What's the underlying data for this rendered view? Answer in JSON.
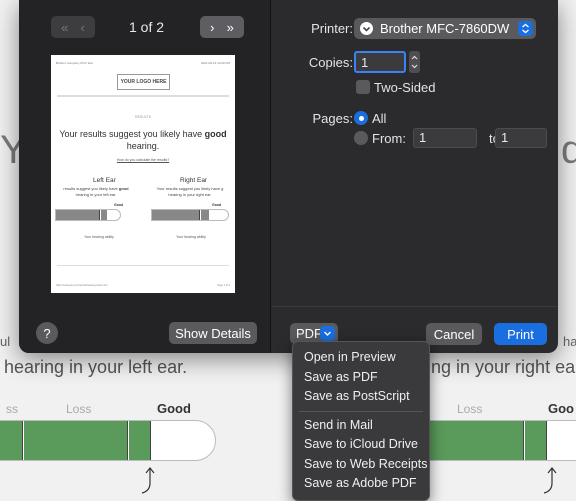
{
  "background": {
    "left_letter": "Y",
    "right_letter": "d",
    "left_line": "hearing in your left ear.",
    "right_line": "ng in your right ear",
    "left_small_clip": "ul",
    "right_small_clip": "ha",
    "scale_loss_clip": "ss",
    "scale_loss": "Loss",
    "scale_good": "Good",
    "scale_loss_right": "Loss",
    "scale_good_right": "Goo"
  },
  "preview": {
    "page_counter": "1 of 2",
    "first_icon": "«",
    "prev_icon": "‹",
    "next_icon": "›",
    "last_icon": "»",
    "paper": {
      "header_left": "Brother Company Print Test",
      "header_right": "2021-09-13 12:00 PM",
      "logo": "YOUR LOGO HERE",
      "results_label": "RESULTS",
      "headline_a": "Your results suggest you likely have",
      "headline_bold": "good",
      "headline_b": "hearing.",
      "link": "How do you calculate the results?",
      "left_ear_title": "Left Ear",
      "left_ear_text_a": "results suggest you likely have",
      "left_ear_text_bold": "good",
      "left_ear_text_b": "hearing in your left ear.",
      "right_ear_title": "Right Ear",
      "right_ear_text_a": "Your results suggest you likely have g",
      "right_ear_text_b": "hearing in your right ear.",
      "scale_good": "Good",
      "ability": "Your hearing ability",
      "footer_url": "https://example.com/results/hearing-test/1-of-2",
      "footer_page": "Page 1 of 2"
    }
  },
  "help_button": "?",
  "show_details_button": "Show Details",
  "printer": {
    "label": "Printer:",
    "value": "Brother MFC-7860DW"
  },
  "copies": {
    "label": "Copies:",
    "value": "1",
    "two_sided_label": "Two-Sided"
  },
  "pages": {
    "label": "Pages:",
    "all_label": "All",
    "from_label": "From:",
    "from_value": "1",
    "to_label": "to:",
    "to_value": "1"
  },
  "pdf_button": "PDF",
  "cancel_button": "Cancel",
  "print_button": "Print",
  "pdf_menu": {
    "items": [
      "Open in Preview",
      "Save as PDF",
      "Save as PostScript"
    ],
    "items2": [
      "Send in Mail",
      "Save to iCloud Drive",
      "Save to Web Receipts",
      "Save as Adobe PDF"
    ]
  },
  "colors": {
    "accent": "#1a6fe0",
    "meter_green": "#5a9a5a",
    "dialog_bg": "#2b2b2d"
  }
}
